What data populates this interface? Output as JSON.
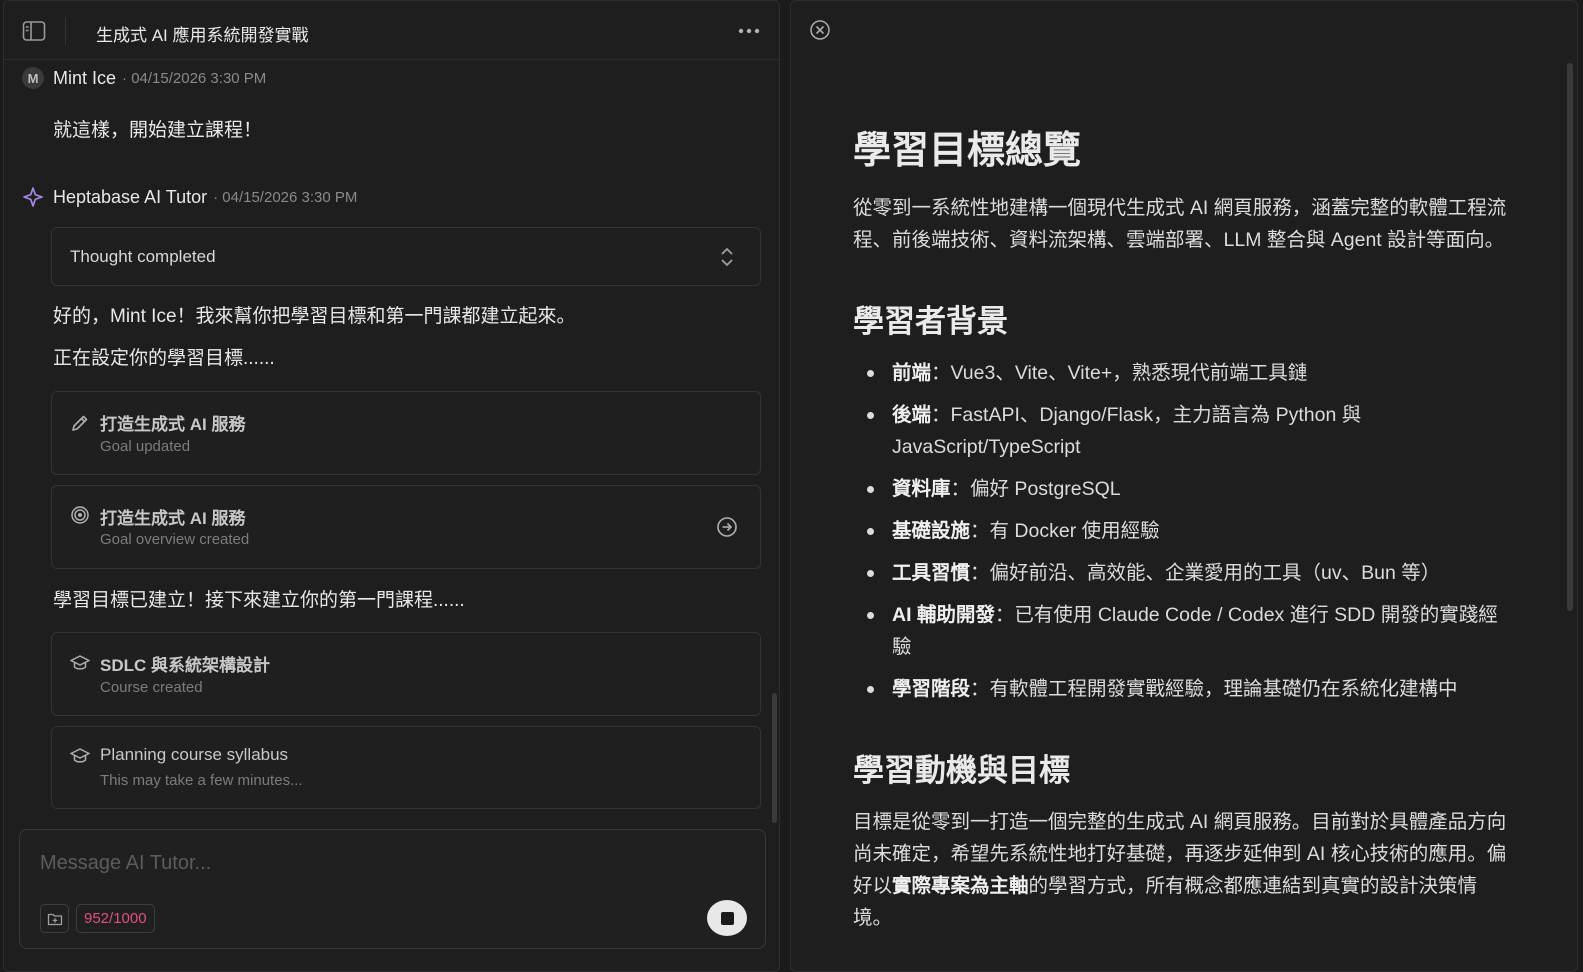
{
  "chat": {
    "title": "生成式 AI 應用系統開發實戰",
    "messages": [
      {
        "avatar": "M",
        "sender": "Mint Ice",
        "timestamp": "· 04/15/2026 3:30 PM",
        "text": "就這樣，開始建立課程！"
      },
      {
        "sender": "Heptabase AI Tutor",
        "timestamp": "· 04/15/2026 3:30 PM"
      }
    ],
    "thought_label": "Thought completed",
    "reply_line1": "好的，Mint Ice！我來幫你把學習目標和第一門課都建立起來。",
    "reply_line2": "正在設定你的學習目標......",
    "cards": [
      {
        "title": "打造生成式 AI 服務",
        "sub": "Goal updated",
        "icon": "pencil-icon"
      },
      {
        "title": "打造生成式 AI 服務",
        "sub": "Goal overview created",
        "icon": "target-icon"
      }
    ],
    "reply_line3": "學習目標已建立！接下來建立你的第一門課程......",
    "course_cards": [
      {
        "title": "SDLC 與系統架構設計",
        "sub": "Course created",
        "icon": "graduation-cap-icon"
      },
      {
        "title": "Planning course syllabus",
        "sub": "This may take a few minutes...",
        "icon": "graduation-cap-icon"
      }
    ],
    "composer": {
      "placeholder": "Message AI Tutor...",
      "char_count": "952/1000"
    }
  },
  "doc": {
    "h1": "學習目標總覽",
    "intro": "從零到一系統性地建構一個現代生成式 AI 網頁服務，涵蓋完整的軟體工程流程、前後端技術、資料流架構、雲端部署、LLM 整合與 Agent 設計等面向。",
    "h2_background": "學習者背景",
    "background_items": [
      {
        "label": "前端",
        "text": "：Vue3、Vite、Vite+，熟悉現代前端工具鏈"
      },
      {
        "label": "後端",
        "text": "：FastAPI、Django/Flask，主力語言為 Python 與 JavaScript/TypeScript"
      },
      {
        "label": "資料庫",
        "text": "：偏好 PostgreSQL"
      },
      {
        "label": "基礎設施",
        "text": "：有 Docker 使用經驗"
      },
      {
        "label": "工具習慣",
        "text": "：偏好前沿、高效能、企業愛用的工具（uv、Bun 等）"
      },
      {
        "label": "AI 輔助開發",
        "text": "：已有使用 Claude Code / Codex 進行 SDD 開發的實踐經驗"
      },
      {
        "label": "學習階段",
        "text": "：有軟體工程開發實戰經驗，理論基礎仍在系統化建構中"
      }
    ],
    "h2_motivation": "學習動機與目標",
    "motivation_pre": "目標是從零到一打造一個完整的生成式 AI 網頁服務。目前對於具體產品方向尚未確定，希望先系統性地打好基礎，再逐步延伸到 AI 核心技術的應用。偏好以",
    "motivation_bold": "實際專案為主軸",
    "motivation_post": "的學習方式，所有概念都應連結到真實的設計決策情境。"
  }
}
